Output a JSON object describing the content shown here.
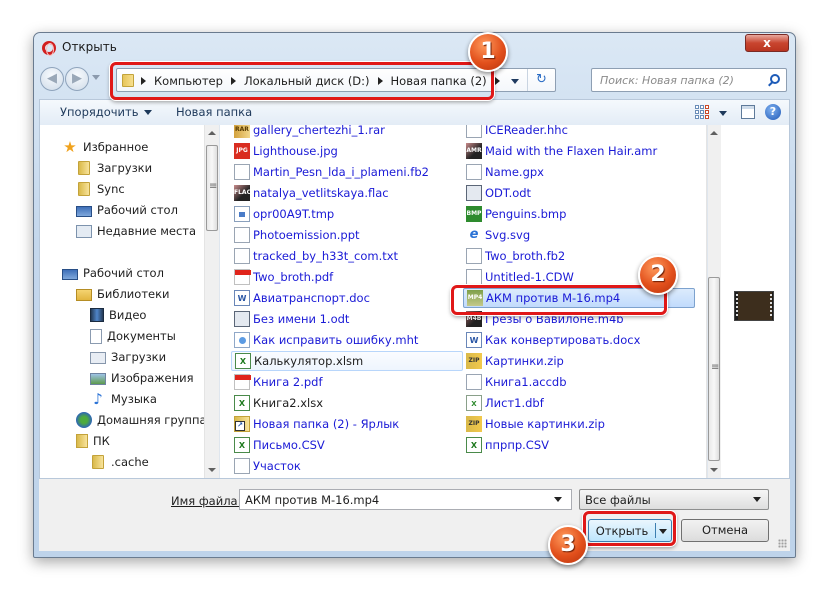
{
  "window": {
    "title": "Открыть",
    "close_label": "x",
    "app_icon": "opera-icon"
  },
  "address_bar": {
    "crumbs": [
      "Компьютер",
      "Локальный диск (D:)",
      "Новая папка (2)"
    ],
    "refresh_icon": "↻"
  },
  "search": {
    "placeholder": "Поиск: Новая папка (2)"
  },
  "toolbar": {
    "organize_label": "Упорядочить",
    "new_folder_label": "Новая папка",
    "help_label": "?"
  },
  "nav_pane": {
    "items": [
      {
        "label": "Избранное",
        "icon": "star-icon"
      },
      {
        "label": "Загрузки",
        "icon": "downloads-folder-icon"
      },
      {
        "label": "Sync",
        "icon": "folder-icon"
      },
      {
        "label": "Рабочий стол",
        "icon": "desktop-icon"
      },
      {
        "label": "Недавние места",
        "icon": "recent-places-icon"
      },
      {
        "label": "Рабочий стол",
        "icon": "desktop-icon"
      },
      {
        "label": "Библиотеки",
        "icon": "libraries-icon"
      },
      {
        "label": "Видео",
        "icon": "video-library-icon"
      },
      {
        "label": "Документы",
        "icon": "documents-library-icon"
      },
      {
        "label": "Загрузки",
        "icon": "downloads-library-icon"
      },
      {
        "label": "Изображения",
        "icon": "pictures-library-icon"
      },
      {
        "label": "Музыка",
        "icon": "music-library-icon"
      },
      {
        "label": "Домашняя группа",
        "icon": "homegroup-icon"
      },
      {
        "label": "ПК",
        "icon": "user-folder-icon"
      },
      {
        "label": ".cache",
        "icon": "folder-icon"
      }
    ]
  },
  "files": {
    "col1": [
      {
        "name": "gallery_chertezhi_1.rar",
        "type": "rar",
        "tag": "RAR"
      },
      {
        "name": "Lighthouse.jpg",
        "type": "jpg",
        "tag": "JPG"
      },
      {
        "name": "Martin_Pesn_lda_i_plameni.fb2",
        "type": "txt",
        "tag": ""
      },
      {
        "name": "natalya_vetlitskaya.flac",
        "type": "flac",
        "tag": "FLAC"
      },
      {
        "name": "opr00A9T.tmp",
        "type": "tmp",
        "tag": ""
      },
      {
        "name": "Photoemission.ppt",
        "type": "txt",
        "tag": ""
      },
      {
        "name": "tracked_by_h33t_com.txt",
        "type": "txt",
        "tag": ""
      },
      {
        "name": "Two_broth.pdf",
        "type": "pdf",
        "tag": ""
      },
      {
        "name": "Авиатранспорт.doc",
        "type": "word",
        "tag": "W"
      },
      {
        "name": "Без имени 1.odt",
        "type": "odt",
        "tag": ""
      },
      {
        "name": "Как исправить ошибку.mht",
        "type": "mht",
        "tag": ""
      },
      {
        "name": "Калькулятор.xlsm",
        "type": "xls",
        "tag": "X",
        "black": true,
        "hover": true
      },
      {
        "name": "Книга 2.pdf",
        "type": "pdf",
        "tag": ""
      },
      {
        "name": "Книга2.xlsx",
        "type": "xls",
        "tag": "X",
        "black": true
      },
      {
        "name": "Новая папка (2) - Ярлык",
        "type": "lnk",
        "tag": ""
      },
      {
        "name": "Письмо.CSV",
        "type": "xls",
        "tag": "X"
      },
      {
        "name": "Участок",
        "type": "txt",
        "tag": ""
      }
    ],
    "col2": [
      {
        "name": "ICEReader.hhc",
        "type": "txt",
        "tag": ""
      },
      {
        "name": "Maid with the Flaxen Hair.amr",
        "type": "amr",
        "tag": "AMR"
      },
      {
        "name": "Name.gpx",
        "type": "txt",
        "tag": ""
      },
      {
        "name": "ODT.odt",
        "type": "odt",
        "tag": ""
      },
      {
        "name": "Penguins.bmp",
        "type": "bmp",
        "tag": "BMP"
      },
      {
        "name": "Svg.svg",
        "type": "svg",
        "tag": "e"
      },
      {
        "name": "Two_broth.fb2",
        "type": "txt",
        "tag": ""
      },
      {
        "name": "Untitled-1.CDW",
        "type": "txt",
        "tag": ""
      },
      {
        "name": "АКМ против М-16.mp4",
        "type": "mp4",
        "tag": "MP4",
        "selected": true
      },
      {
        "name": "Грезы о Вавилоне.m4b",
        "type": "m4b",
        "tag": "M4B"
      },
      {
        "name": "Как конвертировать.docx",
        "type": "word",
        "tag": "W"
      },
      {
        "name": "Картинки.zip",
        "type": "zip",
        "tag": "ZIP"
      },
      {
        "name": "Книга1.accdb",
        "type": "txt",
        "tag": ""
      },
      {
        "name": "Лист1.dbf",
        "type": "dbf",
        "tag": "X"
      },
      {
        "name": "Новые картинки.zip",
        "type": "zip",
        "tag": "ZIP"
      },
      {
        "name": "ппрпр.CSV",
        "type": "xls",
        "tag": "X"
      }
    ]
  },
  "bottom": {
    "filename_label": "Имя файла:",
    "filename_value": "АКМ против М-16.mp4",
    "filter_value": "Все файлы",
    "open_label": "Открыть",
    "cancel_label": "Отмена"
  },
  "annotations": [
    {
      "number": "1",
      "target": "address-bar"
    },
    {
      "number": "2",
      "target": "selected-file"
    },
    {
      "number": "3",
      "target": "open-button"
    }
  ],
  "colors": {
    "highlight": "#e01818",
    "badge": "#e2501c",
    "link_text": "#1a1ad6"
  }
}
